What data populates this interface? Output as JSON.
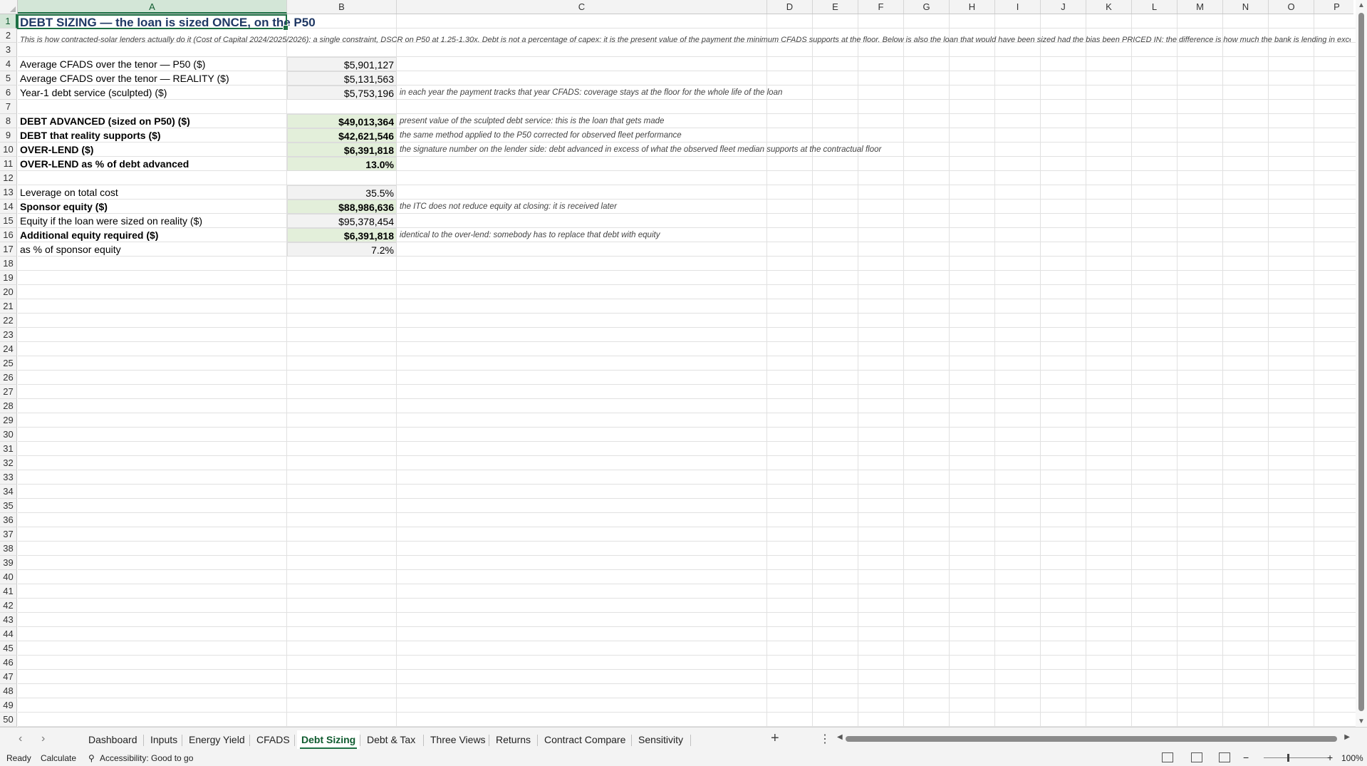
{
  "columns": [
    "A",
    "B",
    "C",
    "D",
    "E",
    "F",
    "G",
    "H",
    "I",
    "J",
    "K",
    "L",
    "M",
    "N",
    "O",
    "P"
  ],
  "row_numbers": [
    "1",
    "2",
    "3",
    "4",
    "5",
    "6",
    "7",
    "8",
    "9",
    "10",
    "11",
    "12",
    "13",
    "14",
    "15",
    "16",
    "17",
    "18",
    "19",
    "20",
    "21",
    "22",
    "23",
    "24",
    "25",
    "26",
    "27",
    "28",
    "29",
    "30",
    "31",
    "32",
    "33",
    "34",
    "35",
    "36",
    "37",
    "38",
    "39",
    "40",
    "41",
    "42",
    "43",
    "44",
    "45",
    "46",
    "47",
    "48",
    "49",
    "50"
  ],
  "sheet": {
    "title": "DEBT SIZING — the loan is sized ONCE, on the P50",
    "subtitle": "This is how contracted-solar lenders actually do it (Cost of Capital 2024/2025/2026): a single constraint, DSCR on P50 at 1.25-1.30x. Debt is not a percentage of capex: it is the present value of the payment the minimum CFADS supports at the floor. Below is also the loan that would have been sized had the bias been PRICED IN: the difference is how much the bank is lending in exce",
    "rows": [
      {
        "r": "4",
        "label": "Average CFADS over the tenor — P50 ($)",
        "value": "$5,901,127",
        "note": "",
        "bold": false,
        "green": false
      },
      {
        "r": "5",
        "label": "Average CFADS over the tenor — REALITY ($)",
        "value": "$5,131,563",
        "note": "",
        "bold": false,
        "green": false
      },
      {
        "r": "6",
        "label": "Year-1 debt service (sculpted) ($)",
        "value": "$5,753,196",
        "note": "in each year the payment tracks that year CFADS: coverage stays at the floor for the whole life of the loan",
        "bold": false,
        "green": false
      },
      {
        "r": "8",
        "label": "DEBT ADVANCED (sized on P50) ($)",
        "value": "$49,013,364",
        "note": "present value of the sculpted debt service: this is the loan that gets made",
        "bold": true,
        "green": true
      },
      {
        "r": "9",
        "label": "DEBT that reality supports ($)",
        "value": "$42,621,546",
        "note": "the same method applied to the P50 corrected for observed fleet performance",
        "bold": true,
        "green": true
      },
      {
        "r": "10",
        "label": "OVER-LEND ($)",
        "value": "$6,391,818",
        "note": "the signature number on the lender side: debt advanced in excess of what the observed fleet median supports at the contractual floor",
        "bold": true,
        "green": true
      },
      {
        "r": "11",
        "label": "OVER-LEND as % of debt advanced",
        "value": "13.0%",
        "note": "",
        "bold": true,
        "green": true
      },
      {
        "r": "13",
        "label": "Leverage on total cost",
        "value": "35.5%",
        "note": "",
        "bold": false,
        "green": false
      },
      {
        "r": "14",
        "label": "Sponsor equity ($)",
        "value": "$88,986,636",
        "note": "the ITC does not reduce equity at closing: it is received later",
        "bold": true,
        "green": true
      },
      {
        "r": "15",
        "label": "Equity if the loan were sized on reality ($)",
        "value": "$95,378,454",
        "note": "",
        "bold": false,
        "green": false
      },
      {
        "r": "16",
        "label": "Additional equity required ($)",
        "value": "$6,391,818",
        "note": "identical to the over-lend: somebody has to replace that debt with equity",
        "bold": true,
        "green": true
      },
      {
        "r": "17",
        "label": "as % of sponsor equity",
        "value": "7.2%",
        "note": "",
        "bold": false,
        "green": false
      }
    ]
  },
  "tabs": [
    "Dashboard",
    "Inputs",
    "Energy Yield",
    "CFADS",
    "Debt Sizing",
    "Debt & Tax",
    "Three Views",
    "Returns",
    "Contract Compare",
    "Sensitivity"
  ],
  "active_tab": "Debt Sizing",
  "status": {
    "ready": "Ready",
    "calculate": "Calculate",
    "accessibility": "Accessibility: Good to go",
    "zoom": "100%"
  },
  "colors": {
    "accent": "#1e7145",
    "title": "#1f3864",
    "green_fill": "#e3efda",
    "grey_fill": "#f2f2f2"
  }
}
